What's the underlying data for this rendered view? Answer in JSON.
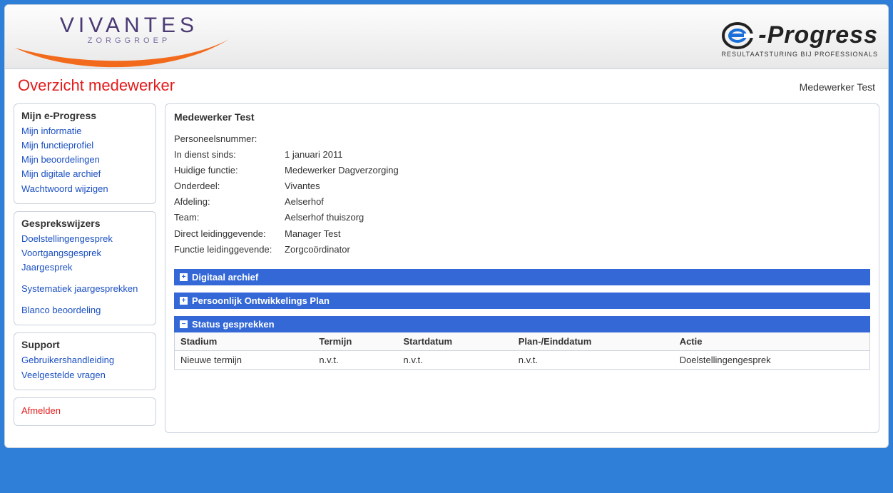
{
  "header": {
    "vivantes_brand": "VIVANTES",
    "vivantes_sub": "ZORGGROEP",
    "eprogress_word": "-Progress",
    "eprogress_tagline": "RESULTAATSTURING BIJ PROFESSIONALS"
  },
  "page": {
    "title": "Overzicht medewerker",
    "user": "Medewerker Test"
  },
  "sidebar": {
    "section1": {
      "heading": "Mijn e-Progress",
      "items": [
        "Mijn informatie",
        "Mijn functieprofiel",
        "Mijn beoordelingen",
        "Mijn digitale archief",
        "Wachtwoord wijzigen"
      ]
    },
    "section2": {
      "heading": "Gesprekswijzers",
      "items_a": [
        "Doelstellingengesprek",
        "Voortgangsgesprek",
        "Jaargesprek"
      ],
      "items_b": [
        "Systematiek jaargesprekken"
      ],
      "items_c": [
        "Blanco beoordeling"
      ]
    },
    "section3": {
      "heading": "Support",
      "items": [
        "Gebruikershandleiding",
        "Veelgestelde vragen"
      ]
    },
    "logout": "Afmelden"
  },
  "main": {
    "name": "Medewerker Test",
    "details": [
      {
        "label": "Personeelsnummer:",
        "value": ""
      },
      {
        "label": "In dienst sinds:",
        "value": "1 januari 2011"
      },
      {
        "label": "Huidige functie:",
        "value": "Medewerker Dagverzorging"
      },
      {
        "label": "Onderdeel:",
        "value": "Vivantes"
      },
      {
        "label": "Afdeling:",
        "value": "Aelserhof"
      },
      {
        "label": "Team:",
        "value": "Aelserhof thuiszorg"
      },
      {
        "label": "Direct leidinggevende:",
        "value": "Manager Test"
      },
      {
        "label": "Functie leidinggevende:",
        "value": "Zorgcoördinator"
      }
    ],
    "panels": {
      "digitaal": {
        "title": "Digitaal archief",
        "expanded": false
      },
      "pop": {
        "title": "Persoonlijk Ontwikkelings Plan",
        "expanded": false
      },
      "status": {
        "title": "Status gesprekken",
        "expanded": true,
        "columns": [
          "Stadium",
          "Termijn",
          "Startdatum",
          "Plan-/Einddatum",
          "Actie"
        ],
        "rows": [
          {
            "stadium": "Nieuwe termijn",
            "termijn": "n.v.t.",
            "startdatum": "n.v.t.",
            "einddatum": "n.v.t.",
            "actie": "Doelstellingengesprek"
          }
        ]
      }
    }
  }
}
